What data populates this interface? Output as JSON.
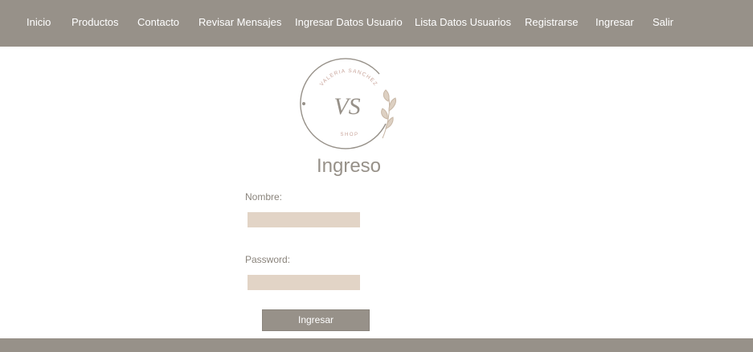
{
  "nav": {
    "items": [
      {
        "label": "Inicio"
      },
      {
        "label": "Productos"
      },
      {
        "label": "Contacto"
      },
      {
        "label": "Revisar Mensajes"
      },
      {
        "label": "Ingresar Datos Usuario"
      },
      {
        "label": "Lista Datos Usuarios"
      },
      {
        "label": "Registrarse"
      },
      {
        "label": "Ingresar"
      },
      {
        "label": "Salir"
      }
    ]
  },
  "logo": {
    "brand_arc": "VALERIA SANCHEZ",
    "monogram": "VS",
    "tagline": "SHOP"
  },
  "page": {
    "title": "Ingreso"
  },
  "form": {
    "name_label": "Nombre:",
    "name_value": "",
    "password_label": "Password:",
    "password_value": "",
    "submit_label": "Ingresar"
  },
  "footer": {
    "text": ""
  },
  "colors": {
    "nav_bg": "#979189",
    "input_bg": "#e2d4c6",
    "title": "#979189",
    "logo_accent": "#c8a49a"
  }
}
